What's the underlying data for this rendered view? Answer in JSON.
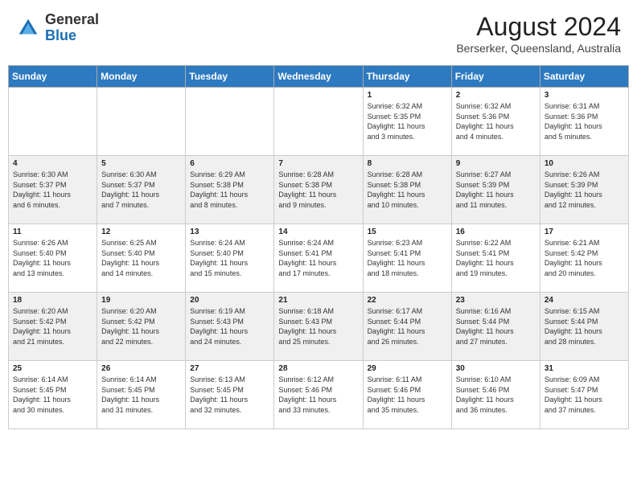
{
  "header": {
    "logo": {
      "line1": "General",
      "line2": "Blue"
    },
    "title": "August 2024",
    "location": "Berserker, Queensland, Australia"
  },
  "weekdays": [
    "Sunday",
    "Monday",
    "Tuesday",
    "Wednesday",
    "Thursday",
    "Friday",
    "Saturday"
  ],
  "weeks": [
    [
      {
        "day": "",
        "info": ""
      },
      {
        "day": "",
        "info": ""
      },
      {
        "day": "",
        "info": ""
      },
      {
        "day": "",
        "info": ""
      },
      {
        "day": "1",
        "info": "Sunrise: 6:32 AM\nSunset: 5:35 PM\nDaylight: 11 hours\nand 3 minutes."
      },
      {
        "day": "2",
        "info": "Sunrise: 6:32 AM\nSunset: 5:36 PM\nDaylight: 11 hours\nand 4 minutes."
      },
      {
        "day": "3",
        "info": "Sunrise: 6:31 AM\nSunset: 5:36 PM\nDaylight: 11 hours\nand 5 minutes."
      }
    ],
    [
      {
        "day": "4",
        "info": "Sunrise: 6:30 AM\nSunset: 5:37 PM\nDaylight: 11 hours\nand 6 minutes."
      },
      {
        "day": "5",
        "info": "Sunrise: 6:30 AM\nSunset: 5:37 PM\nDaylight: 11 hours\nand 7 minutes."
      },
      {
        "day": "6",
        "info": "Sunrise: 6:29 AM\nSunset: 5:38 PM\nDaylight: 11 hours\nand 8 minutes."
      },
      {
        "day": "7",
        "info": "Sunrise: 6:28 AM\nSunset: 5:38 PM\nDaylight: 11 hours\nand 9 minutes."
      },
      {
        "day": "8",
        "info": "Sunrise: 6:28 AM\nSunset: 5:38 PM\nDaylight: 11 hours\nand 10 minutes."
      },
      {
        "day": "9",
        "info": "Sunrise: 6:27 AM\nSunset: 5:39 PM\nDaylight: 11 hours\nand 11 minutes."
      },
      {
        "day": "10",
        "info": "Sunrise: 6:26 AM\nSunset: 5:39 PM\nDaylight: 11 hours\nand 12 minutes."
      }
    ],
    [
      {
        "day": "11",
        "info": "Sunrise: 6:26 AM\nSunset: 5:40 PM\nDaylight: 11 hours\nand 13 minutes."
      },
      {
        "day": "12",
        "info": "Sunrise: 6:25 AM\nSunset: 5:40 PM\nDaylight: 11 hours\nand 14 minutes."
      },
      {
        "day": "13",
        "info": "Sunrise: 6:24 AM\nSunset: 5:40 PM\nDaylight: 11 hours\nand 15 minutes."
      },
      {
        "day": "14",
        "info": "Sunrise: 6:24 AM\nSunset: 5:41 PM\nDaylight: 11 hours\nand 17 minutes."
      },
      {
        "day": "15",
        "info": "Sunrise: 6:23 AM\nSunset: 5:41 PM\nDaylight: 11 hours\nand 18 minutes."
      },
      {
        "day": "16",
        "info": "Sunrise: 6:22 AM\nSunset: 5:41 PM\nDaylight: 11 hours\nand 19 minutes."
      },
      {
        "day": "17",
        "info": "Sunrise: 6:21 AM\nSunset: 5:42 PM\nDaylight: 11 hours\nand 20 minutes."
      }
    ],
    [
      {
        "day": "18",
        "info": "Sunrise: 6:20 AM\nSunset: 5:42 PM\nDaylight: 11 hours\nand 21 minutes."
      },
      {
        "day": "19",
        "info": "Sunrise: 6:20 AM\nSunset: 5:42 PM\nDaylight: 11 hours\nand 22 minutes."
      },
      {
        "day": "20",
        "info": "Sunrise: 6:19 AM\nSunset: 5:43 PM\nDaylight: 11 hours\nand 24 minutes."
      },
      {
        "day": "21",
        "info": "Sunrise: 6:18 AM\nSunset: 5:43 PM\nDaylight: 11 hours\nand 25 minutes."
      },
      {
        "day": "22",
        "info": "Sunrise: 6:17 AM\nSunset: 5:44 PM\nDaylight: 11 hours\nand 26 minutes."
      },
      {
        "day": "23",
        "info": "Sunrise: 6:16 AM\nSunset: 5:44 PM\nDaylight: 11 hours\nand 27 minutes."
      },
      {
        "day": "24",
        "info": "Sunrise: 6:15 AM\nSunset: 5:44 PM\nDaylight: 11 hours\nand 28 minutes."
      }
    ],
    [
      {
        "day": "25",
        "info": "Sunrise: 6:14 AM\nSunset: 5:45 PM\nDaylight: 11 hours\nand 30 minutes."
      },
      {
        "day": "26",
        "info": "Sunrise: 6:14 AM\nSunset: 5:45 PM\nDaylight: 11 hours\nand 31 minutes."
      },
      {
        "day": "27",
        "info": "Sunrise: 6:13 AM\nSunset: 5:45 PM\nDaylight: 11 hours\nand 32 minutes."
      },
      {
        "day": "28",
        "info": "Sunrise: 6:12 AM\nSunset: 5:46 PM\nDaylight: 11 hours\nand 33 minutes."
      },
      {
        "day": "29",
        "info": "Sunrise: 6:11 AM\nSunset: 5:46 PM\nDaylight: 11 hours\nand 35 minutes."
      },
      {
        "day": "30",
        "info": "Sunrise: 6:10 AM\nSunset: 5:46 PM\nDaylight: 11 hours\nand 36 minutes."
      },
      {
        "day": "31",
        "info": "Sunrise: 6:09 AM\nSunset: 5:47 PM\nDaylight: 11 hours\nand 37 minutes."
      }
    ]
  ]
}
